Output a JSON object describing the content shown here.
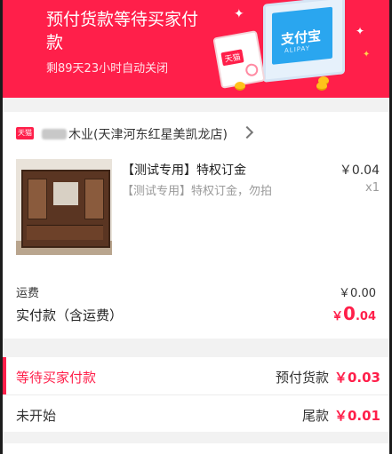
{
  "banner": {
    "title": "预付货款等待买家付款",
    "countdown": "剩89天23小时自动关闭",
    "illustration": {
      "monitor_logo": "支付宝",
      "monitor_logo_sub": "ALIPAY",
      "card_badge": "天猫"
    }
  },
  "store": {
    "platform_icon": "天猫",
    "name": "木业(天津河东红星美凯龙店)"
  },
  "product": {
    "title": "【测试专用】特权订金",
    "description": "【测试专用】特权订金，勿拍",
    "price": "￥0.04",
    "quantity": "x1"
  },
  "fees": {
    "shipping_label": "运费",
    "shipping_value": "￥0.00",
    "total_label": "实付款（含运费）",
    "total_currency": "￥",
    "total_int": "0",
    "total_dec": ".04"
  },
  "payments": [
    {
      "status": "等待买家付款",
      "type": "预付货款",
      "amount": "￥0.03",
      "active": true
    },
    {
      "status": "未开始",
      "type": "尾款",
      "amount": "￥0.01",
      "active": false
    }
  ],
  "colors": {
    "accent": "#ff1f4a",
    "page_bg": "#f2f2f2",
    "alipay_blue": "#2aa6ef"
  }
}
